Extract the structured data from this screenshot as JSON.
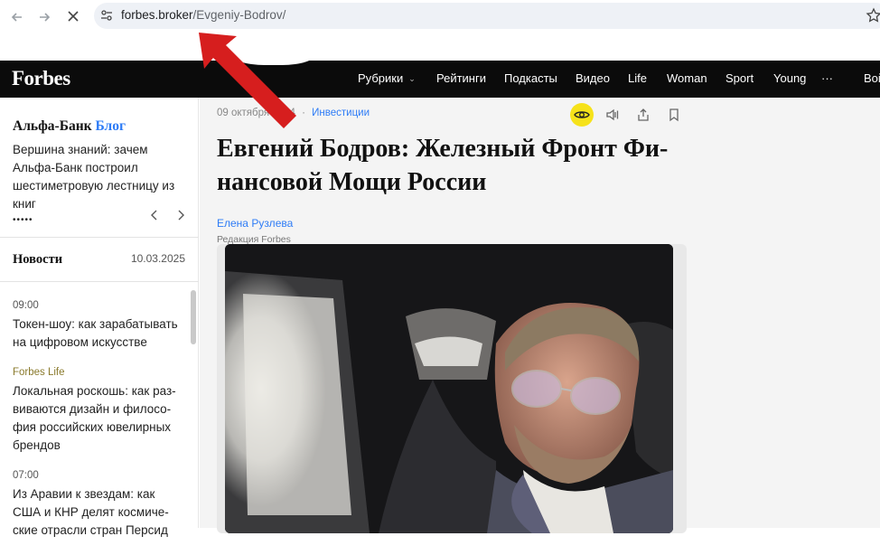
{
  "browser": {
    "url_domain": "forbes.broker",
    "url_path": "/Evgeniy-Bodrov/"
  },
  "header": {
    "logo": "Forbes",
    "menu": [
      "Рубрики",
      "Рейтинги",
      "Подкасты",
      "Видео",
      "Life",
      "Woman",
      "Sport",
      "Young",
      "···",
      "Вой"
    ]
  },
  "sidebar": {
    "blog_brand": "Альфа-Банк",
    "blog_label": "Блог",
    "blog_text": "Вершина знаний: зачем Альфа-Банк построил шестиметровую лестницу из книг",
    "dots": "•••••",
    "news_title": "Новости",
    "news_date": "10.03.2025",
    "news": [
      {
        "meta": "09:00",
        "head": "Токен-шоу: как зарабатывать на цифровом искусстве"
      },
      {
        "meta": "Forbes Life",
        "head": "Локальная роскошь: как раз-виваются дизайн и филосо-фия российских ювелирных брендов"
      },
      {
        "meta": "07:00",
        "head": "Из Аравии к звездам: как США и КНР делят космиче-ские отрасли стран Персид"
      }
    ]
  },
  "article": {
    "date": "09 октября 2024",
    "rubric": "Инвестиции",
    "headline": "Евгений Бодров: Железный Фронт Фи-нансовой Мощи России",
    "author": "Елена Рузлева",
    "author_role": "Редакция Forbes"
  },
  "colors": {
    "accent_blue": "#2e7cf6",
    "header_bg": "#0b0b0b",
    "eye_highlight": "#f6e21a",
    "arrow_red": "#d61e1e"
  }
}
